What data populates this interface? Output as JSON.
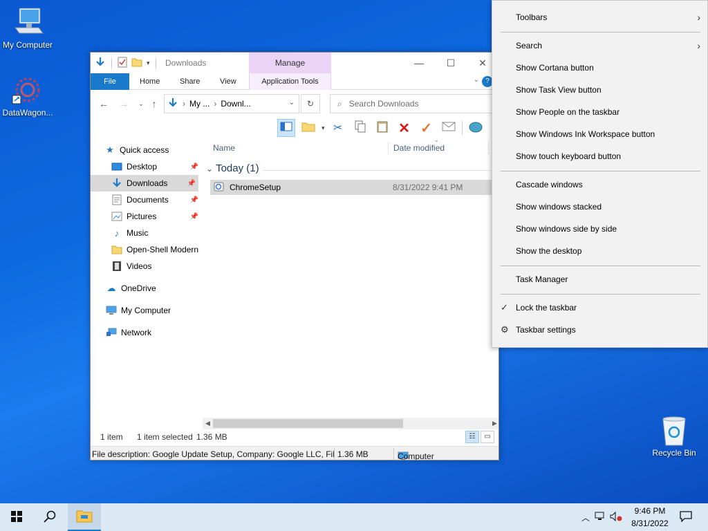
{
  "desktop": {
    "icons": [
      {
        "label": "My Computer",
        "icon": "computer-icon"
      },
      {
        "label": "DataWagon...",
        "icon": "datawagon-icon"
      },
      {
        "label": "Recycle Bin",
        "icon": "recycle-bin-icon"
      }
    ]
  },
  "explorer": {
    "title": "Downloads",
    "manage_tab": "Manage",
    "ribbon_tabs": [
      "File",
      "Home",
      "Share",
      "View",
      "Application Tools"
    ],
    "address": {
      "crumbs": [
        "My ...",
        "Downl..."
      ]
    },
    "search_placeholder": "Search Downloads",
    "nav": {
      "quick_access": "Quick access",
      "items": [
        "Desktop",
        "Downloads",
        "Documents",
        "Pictures",
        "Music",
        "Open-Shell Modern",
        "Videos"
      ],
      "onedrive": "OneDrive",
      "my_computer": "My Computer",
      "network": "Network"
    },
    "columns": {
      "name": "Name",
      "date": "Date modified"
    },
    "group": "Today (1)",
    "files": [
      {
        "name": "ChromeSetup",
        "date": "8/31/2022 9:41 PM"
      }
    ],
    "status": {
      "count": "1 item",
      "selected": "1 item selected",
      "size": "1.36 MB"
    },
    "details": {
      "description": "File description: Google Update Setup, Company: Google LLC, File",
      "size": "1.36 MB",
      "location": "Computer"
    }
  },
  "context_menu": {
    "toolbars": "Toolbars",
    "search": "Search",
    "show_cortana": "Show Cortana button",
    "show_task_view": "Show Task View button",
    "show_people": "Show People on the taskbar",
    "show_ink": "Show Windows Ink Workspace button",
    "show_touch_kb": "Show touch keyboard button",
    "cascade": "Cascade windows",
    "stacked": "Show windows stacked",
    "side_by_side": "Show windows side by side",
    "show_desktop": "Show the desktop",
    "task_manager": "Task Manager",
    "lock_taskbar": "Lock the taskbar",
    "taskbar_settings": "Taskbar settings"
  },
  "taskbar": {
    "time": "9:46 PM",
    "date": "8/31/2022"
  },
  "colors": {
    "accent": "#1979ca",
    "manage": "#ead3f5",
    "taskbar": "#dbe9f5",
    "desktop": "#0d6ae0"
  }
}
